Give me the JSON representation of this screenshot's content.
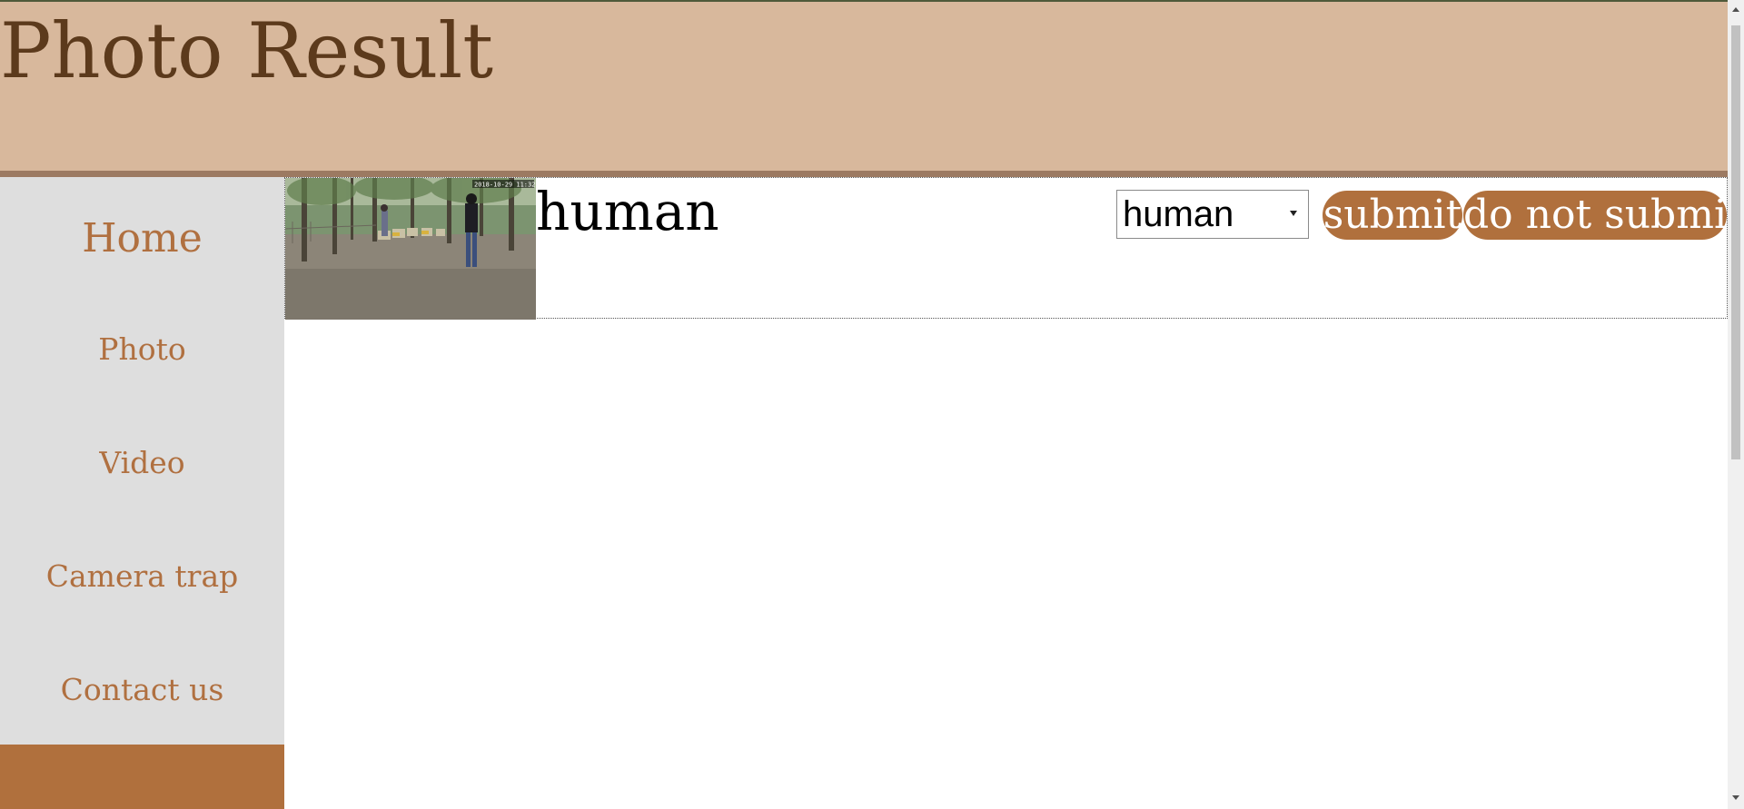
{
  "header": {
    "title": "Photo Result"
  },
  "sidebar": {
    "items": [
      {
        "label": "Home"
      },
      {
        "label": "Photo"
      },
      {
        "label": "Video"
      },
      {
        "label": "Camera trap"
      },
      {
        "label": "Contact us"
      }
    ]
  },
  "results": [
    {
      "detected_label": "human",
      "selected_class": "human",
      "thumbnail_timestamp": "2018-10-29 11:32:34",
      "submit_label": "submit",
      "do_not_submit_label": "do not submit"
    }
  ],
  "colors": {
    "header_bg": "#d8b89c",
    "title_color": "#5c3a1c",
    "accent": "#b0703d",
    "sidebar_bg": "#dedede"
  }
}
